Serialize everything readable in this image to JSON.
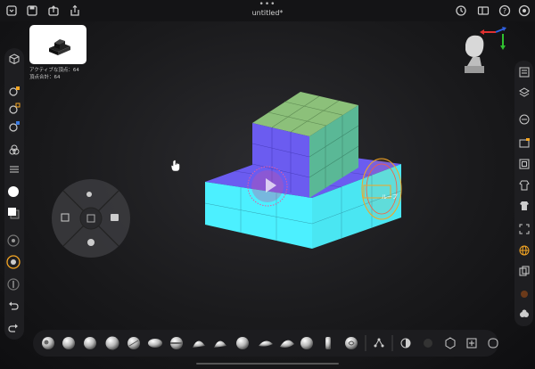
{
  "app": {
    "title": "untitled*",
    "more": "•••"
  },
  "stats": {
    "active_vertices": "アクティブな頂点：64",
    "total_vertices": "頂点合計：64"
  },
  "brush_label": "ループ",
  "colors": {
    "accent": "#f5a623",
    "mesh_top": "#8cc07a",
    "mesh_side_purple": "#6b5cf0",
    "mesh_side_cyan": "#4cf0ff"
  },
  "icons": {
    "top": [
      "folder-icon",
      "save-icon",
      "export-icon",
      "share-icon",
      "history-icon",
      "layout-icon",
      "help-icon",
      "settings-icon"
    ],
    "left": [
      "cube-icon",
      "material-icon",
      "paint-icon",
      "dynamics-icon",
      "shapes-icon",
      "sliders-icon",
      "color-white-icon",
      "color-swatch-icon",
      "focal-icon",
      "rotate-icon",
      "stroke-icon",
      "undo-icon",
      "redo-icon"
    ],
    "right": [
      "list-icon",
      "layers-icon",
      "minus-icon",
      "box-icon",
      "frame-icon",
      "shirt-icon",
      "shirt-outline-icon",
      "expand-icon",
      "globe-icon",
      "copy-icon",
      "pot-icon",
      "blob-icon"
    ],
    "bottom": [
      "brush-clay-icon",
      "brush-standard-icon",
      "brush-sphere-icon",
      "brush-inflate-icon",
      "brush-crease-icon",
      "brush-move-icon",
      "brush-flatten-icon",
      "brush-pinch-icon",
      "brush-smooth-icon",
      "brush-mask-icon",
      "brush-trim-icon",
      "brush-snake-icon",
      "brush-elastic-icon",
      "brush-figure-icon",
      "brush-spiral-icon",
      "pose-icon",
      "contrast-icon",
      "blur-icon",
      "cube-outline-icon",
      "plus-square-icon",
      "pill-icon"
    ]
  }
}
